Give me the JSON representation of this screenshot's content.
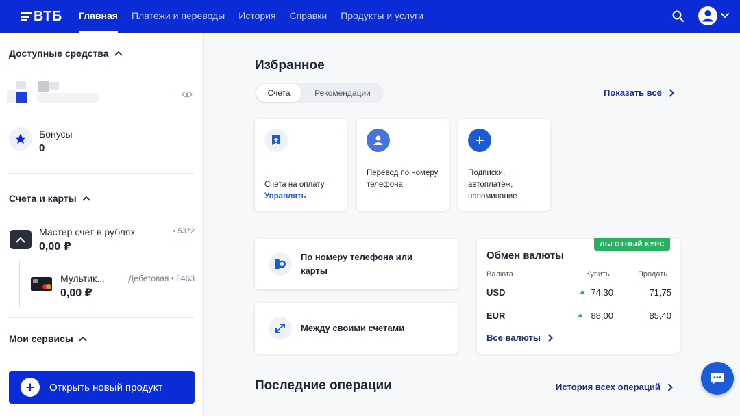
{
  "brand": {
    "name": "ВТБ"
  },
  "nav": {
    "items": [
      {
        "label": "Главная",
        "active": true
      },
      {
        "label": "Платежи и переводы"
      },
      {
        "label": "История"
      },
      {
        "label": "Справки"
      },
      {
        "label": "Продукты и услуги"
      }
    ]
  },
  "sidebar": {
    "available_title": "Доступные средства",
    "bonus_label": "Бонусы",
    "bonus_value": "0",
    "accounts_title": "Счета и карты",
    "account": {
      "name": "Мастер счет в рублях",
      "number": "• 5372",
      "balance": "0,00 ₽"
    },
    "card": {
      "name": "Мультик...",
      "type": "Дебетовая • 8463",
      "balance": "0,00 ₽"
    },
    "services_title": "Мои сервисы",
    "open_product": "Открыть новый продукт"
  },
  "favorites": {
    "title": "Избранное",
    "tabs": [
      {
        "label": "Счета",
        "active": true
      },
      {
        "label": "Рекомендации"
      }
    ],
    "show_all": "Показать всё",
    "tiles": [
      {
        "text": "Счета на оплату",
        "sub": "Управлять"
      },
      {
        "text": "Перевод по номеру телефона"
      },
      {
        "text": "Подписки, автоплатёж, напоминание"
      }
    ]
  },
  "transfers": {
    "phone": "По номеру телефона или карты",
    "own": "Между своими счетами"
  },
  "fx": {
    "badge": "ЛЬГОТНЫЙ КУРС",
    "title": "Обмен валюты",
    "col_currency": "Валюта",
    "col_buy": "Купить",
    "col_sell": "Продать",
    "rows": [
      {
        "currency": "USD",
        "buy": "74,30",
        "sell": "71,75"
      },
      {
        "currency": "EUR",
        "buy": "88,00",
        "sell": "85,40"
      }
    ],
    "all_link": "Все валюты"
  },
  "operations": {
    "title": "Последние операции",
    "history_link": "История всех операций"
  },
  "colors": {
    "brand": "#0a2bd6",
    "link": "#1b2e8c",
    "accent": "#1b5bd6",
    "up": "#24b35f"
  }
}
